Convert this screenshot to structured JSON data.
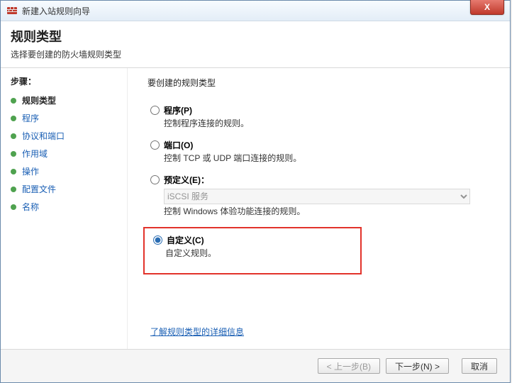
{
  "window": {
    "title": "新建入站规则向导",
    "close": "X"
  },
  "header": {
    "h1": "规则类型",
    "sub": "选择要创建的防火墙规则类型"
  },
  "sidebar": {
    "title": "步骤：",
    "items": [
      "规则类型",
      "程序",
      "协议和端口",
      "作用域",
      "操作",
      "配置文件",
      "名称"
    ],
    "currentIndex": 0
  },
  "content": {
    "title": "要创建的规则类型",
    "options": {
      "program": {
        "label": "程序(P)",
        "desc": "控制程序连接的规则。"
      },
      "port": {
        "label": "端口(O)",
        "desc": "控制 TCP 或 UDP 端口连接的规则。"
      },
      "predefined": {
        "label": "预定义(E)：",
        "desc": "控制 Windows 体验功能连接的规则。",
        "select": "iSCSI 服务"
      },
      "custom": {
        "label": "自定义(C)",
        "desc": "自定义规则。"
      }
    },
    "selected": "custom",
    "link": "了解规则类型的详细信息"
  },
  "footer": {
    "back": "< 上一步(B)",
    "next": "下一步(N) >",
    "cancel": "取消"
  }
}
